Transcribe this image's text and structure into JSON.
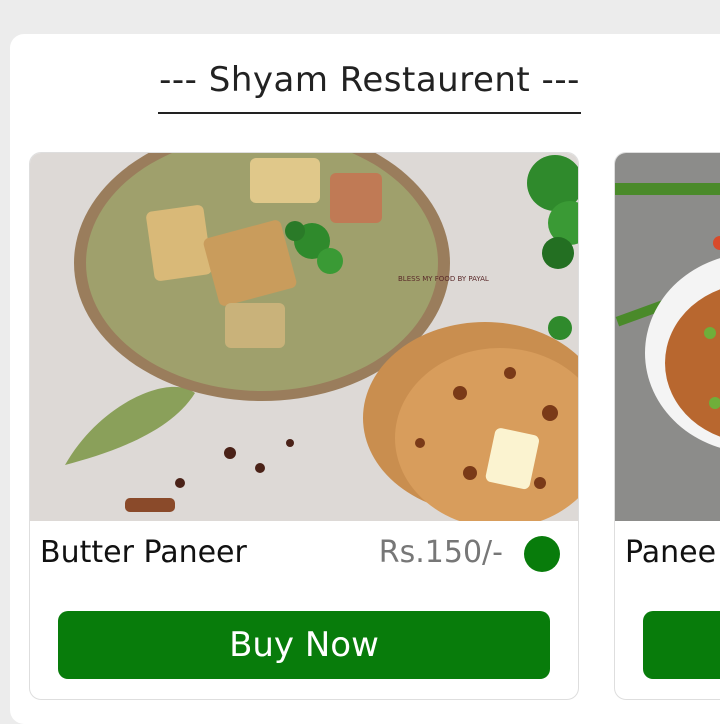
{
  "restaurant": {
    "title": "--- Shyam Restaurent ---"
  },
  "colors": {
    "accent": "#087c0b",
    "veg_indicator": "#087c0b"
  },
  "items": [
    {
      "name": "Butter Paneer",
      "price": "Rs.150/-",
      "button_label": "Buy Now",
      "veg": true,
      "photo_watermark": "BLESS MY FOOD BY PAYAL"
    },
    {
      "name": "Panee",
      "button_label": ""
    }
  ]
}
